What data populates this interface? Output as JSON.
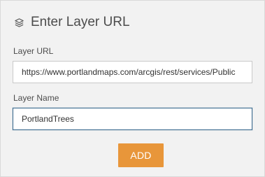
{
  "header": {
    "icon": "layers-icon",
    "title": "Enter Layer URL"
  },
  "form": {
    "layer_url_label": "Layer URL",
    "layer_url_value": "https://www.portlandmaps.com/arcgis/rest/services/Public",
    "layer_name_label": "Layer Name",
    "layer_name_value": "PortlandTrees"
  },
  "actions": {
    "add_label": "ADD"
  },
  "colors": {
    "panel_bg": "#f2f2f2",
    "button_bg": "#e8963a",
    "focus_border": "#3a6a8f"
  }
}
